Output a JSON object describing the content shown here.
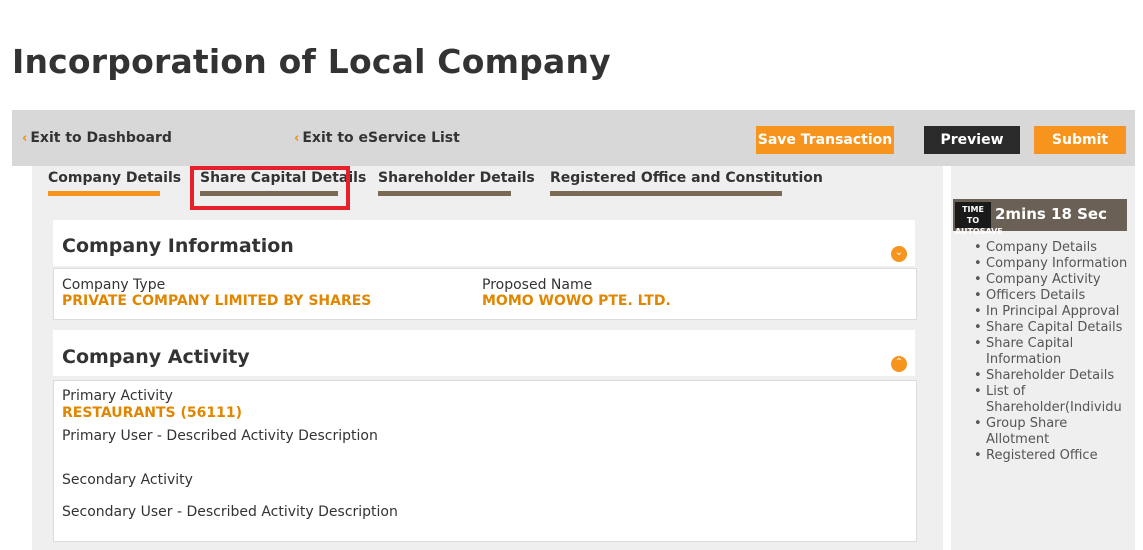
{
  "page": {
    "title": "Incorporation of Local Company"
  },
  "topbar": {
    "exit_dashboard": "Exit to Dashboard",
    "exit_eservice": "Exit to eService List",
    "save_transaction": "Save Transaction",
    "preview": "Preview",
    "submit": "Submit",
    "chevron": "‹"
  },
  "tabs": [
    {
      "label": "Company Details",
      "underline_color": "#f7941d"
    },
    {
      "label": "Share Capital Details",
      "underline_color": "#7a6a55"
    },
    {
      "label": "Shareholder Details",
      "underline_color": "#7a6a55"
    },
    {
      "label": "Registered Office and Constitution",
      "underline_color": "#7a6a55"
    }
  ],
  "company_information": {
    "title": "Company Information",
    "company_type_label": "Company Type",
    "company_type_value": "PRIVATE COMPANY LIMITED BY SHARES",
    "proposed_name_label": "Proposed Name",
    "proposed_name_value": "MOMO WOWO PTE. LTD."
  },
  "company_activity": {
    "title": "Company Activity",
    "primary_activity_label": "Primary Activity",
    "primary_activity_value": "RESTAURANTS (56111)",
    "primary_user_desc_label": "Primary User - Described Activity Description",
    "secondary_activity_label": "Secondary Activity",
    "secondary_user_desc_label": "Secondary User - Described Activity Description"
  },
  "autosave": {
    "label_line1": "TIME TO",
    "label_line2": "AUTOSAVE",
    "remaining": "2mins 18 Sec"
  },
  "outline": [
    "Company Details",
    "Company Information",
    "Company Activity",
    "Officers Details",
    "In Principal Approval",
    "Share Capital Details",
    "Share Capital Information",
    "Shareholder Details",
    "List of Shareholder(Individu",
    "Group Share Allotment",
    "Registered Office"
  ],
  "colors": {
    "accent": "#f7941d",
    "value_text": "#e08600",
    "highlight": "#e8202a",
    "dark_button": "#2a2a2a"
  }
}
